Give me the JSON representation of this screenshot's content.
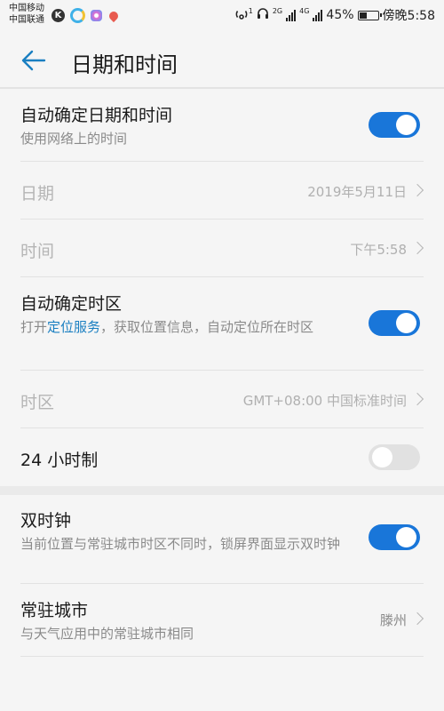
{
  "status_bar": {
    "carrier1": "中国移动",
    "carrier2": "中国联通",
    "app_icon_k": "K",
    "hotspot_sup": "1",
    "net2g": "2G",
    "net4g": "4G",
    "battery_pct": "45%",
    "battery_level": 0.45,
    "time": "傍晚5:58"
  },
  "header": {
    "title": "日期和时间"
  },
  "rows": {
    "auto_datetime": {
      "title": "自动确定日期和时间",
      "subtitle": "使用网络上的时间",
      "toggle": true
    },
    "date": {
      "title": "日期",
      "value": "2019年5月11日"
    },
    "time": {
      "title": "时间",
      "value": "下午5:58"
    },
    "auto_tz": {
      "title": "自动确定时区",
      "sub_prefix": "打开",
      "sub_link": "定位服务",
      "sub_suffix": "，获取位置信息，自动定位所在时区",
      "toggle": true
    },
    "timezone": {
      "title": "时区",
      "value": "GMT+08:00 中国标准时间"
    },
    "h24": {
      "title": "24 小时制",
      "toggle": false
    },
    "dual_clock": {
      "title": "双时钟",
      "subtitle": "当前位置与常驻城市时区不同时，锁屏界面显示双时钟",
      "toggle": true
    },
    "home_city": {
      "title": "常驻城市",
      "subtitle": "与天气应用中的常驻城市相同",
      "value": "滕州"
    }
  },
  "colors": {
    "accent": "#1976d9",
    "link": "#1a7fc1"
  }
}
